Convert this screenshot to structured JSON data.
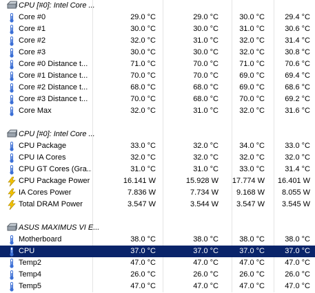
{
  "sections": [
    {
      "title": "CPU [#0]: Intel Core ...",
      "icon": "chip-icon",
      "rows": [
        {
          "label": "Core #0",
          "icon": "thermometer-icon",
          "values": [
            "29.0 °C",
            "29.0 °C",
            "30.0 °C",
            "29.4 °C"
          ]
        },
        {
          "label": "Core #1",
          "icon": "thermometer-icon",
          "values": [
            "30.0 °C",
            "30.0 °C",
            "31.0 °C",
            "30.6 °C"
          ]
        },
        {
          "label": "Core #2",
          "icon": "thermometer-icon",
          "values": [
            "32.0 °C",
            "31.0 °C",
            "32.0 °C",
            "31.4 °C"
          ]
        },
        {
          "label": "Core #3",
          "icon": "thermometer-icon",
          "values": [
            "30.0 °C",
            "30.0 °C",
            "32.0 °C",
            "30.8 °C"
          ]
        },
        {
          "label": "Core #0 Distance t...",
          "icon": "thermometer-icon",
          "values": [
            "71.0 °C",
            "70.0 °C",
            "71.0 °C",
            "70.6 °C"
          ]
        },
        {
          "label": "Core #1 Distance t...",
          "icon": "thermometer-icon",
          "values": [
            "70.0 °C",
            "70.0 °C",
            "69.0 °C",
            "69.4 °C"
          ]
        },
        {
          "label": "Core #2 Distance t...",
          "icon": "thermometer-icon",
          "values": [
            "68.0 °C",
            "68.0 °C",
            "69.0 °C",
            "68.6 °C"
          ]
        },
        {
          "label": "Core #3 Distance t...",
          "icon": "thermometer-icon",
          "values": [
            "70.0 °C",
            "68.0 °C",
            "70.0 °C",
            "69.2 °C"
          ]
        },
        {
          "label": "Core Max",
          "icon": "thermometer-icon",
          "values": [
            "32.0 °C",
            "31.0 °C",
            "32.0 °C",
            "31.6 °C"
          ]
        }
      ]
    },
    {
      "title": "CPU [#0]: Intel Core ...",
      "icon": "chip-icon",
      "rows": [
        {
          "label": "CPU Package",
          "icon": "thermometer-icon",
          "values": [
            "33.0 °C",
            "32.0 °C",
            "34.0 °C",
            "33.0 °C"
          ]
        },
        {
          "label": "CPU IA Cores",
          "icon": "thermometer-icon",
          "values": [
            "32.0 °C",
            "32.0 °C",
            "32.0 °C",
            "32.0 °C"
          ]
        },
        {
          "label": "CPU GT Cores (Gra...",
          "icon": "thermometer-icon",
          "values": [
            "31.0 °C",
            "31.0 °C",
            "33.0 °C",
            "31.4 °C"
          ]
        },
        {
          "label": "CPU Package Power",
          "icon": "lightning-icon",
          "values": [
            "16.141 W",
            "15.928 W",
            "17.774 W",
            "16.401 W"
          ]
        },
        {
          "label": "IA Cores Power",
          "icon": "lightning-icon",
          "values": [
            "7.836 W",
            "7.734 W",
            "9.168 W",
            "8.055 W"
          ]
        },
        {
          "label": "Total DRAM Power",
          "icon": "lightning-icon",
          "values": [
            "3.547 W",
            "3.544 W",
            "3.547 W",
            "3.545 W"
          ]
        }
      ]
    },
    {
      "title": "ASUS MAXIMUS VI E...",
      "icon": "chip-icon",
      "rows": [
        {
          "label": "Motherboard",
          "icon": "thermometer-icon",
          "values": [
            "38.0 °C",
            "38.0 °C",
            "38.0 °C",
            "38.0 °C"
          ]
        },
        {
          "label": "CPU",
          "icon": "thermometer-icon",
          "values": [
            "37.0 °C",
            "37.0 °C",
            "37.0 °C",
            "37.0 °C"
          ],
          "selected": true
        },
        {
          "label": "Temp2",
          "icon": "thermometer-icon",
          "values": [
            "47.0 °C",
            "47.0 °C",
            "47.0 °C",
            "47.0 °C"
          ]
        },
        {
          "label": "Temp4",
          "icon": "thermometer-icon",
          "values": [
            "26.0 °C",
            "26.0 °C",
            "26.0 °C",
            "26.0 °C"
          ]
        },
        {
          "label": "Temp5",
          "icon": "thermometer-icon",
          "values": [
            "47.0 °C",
            "47.0 °C",
            "47.0 °C",
            "47.0 °C"
          ]
        }
      ]
    }
  ],
  "colors": {
    "selection": "#0a246a",
    "grid": "#e4e4e4",
    "thermo": "#3b6fd6",
    "bolt": "#f2c200"
  }
}
